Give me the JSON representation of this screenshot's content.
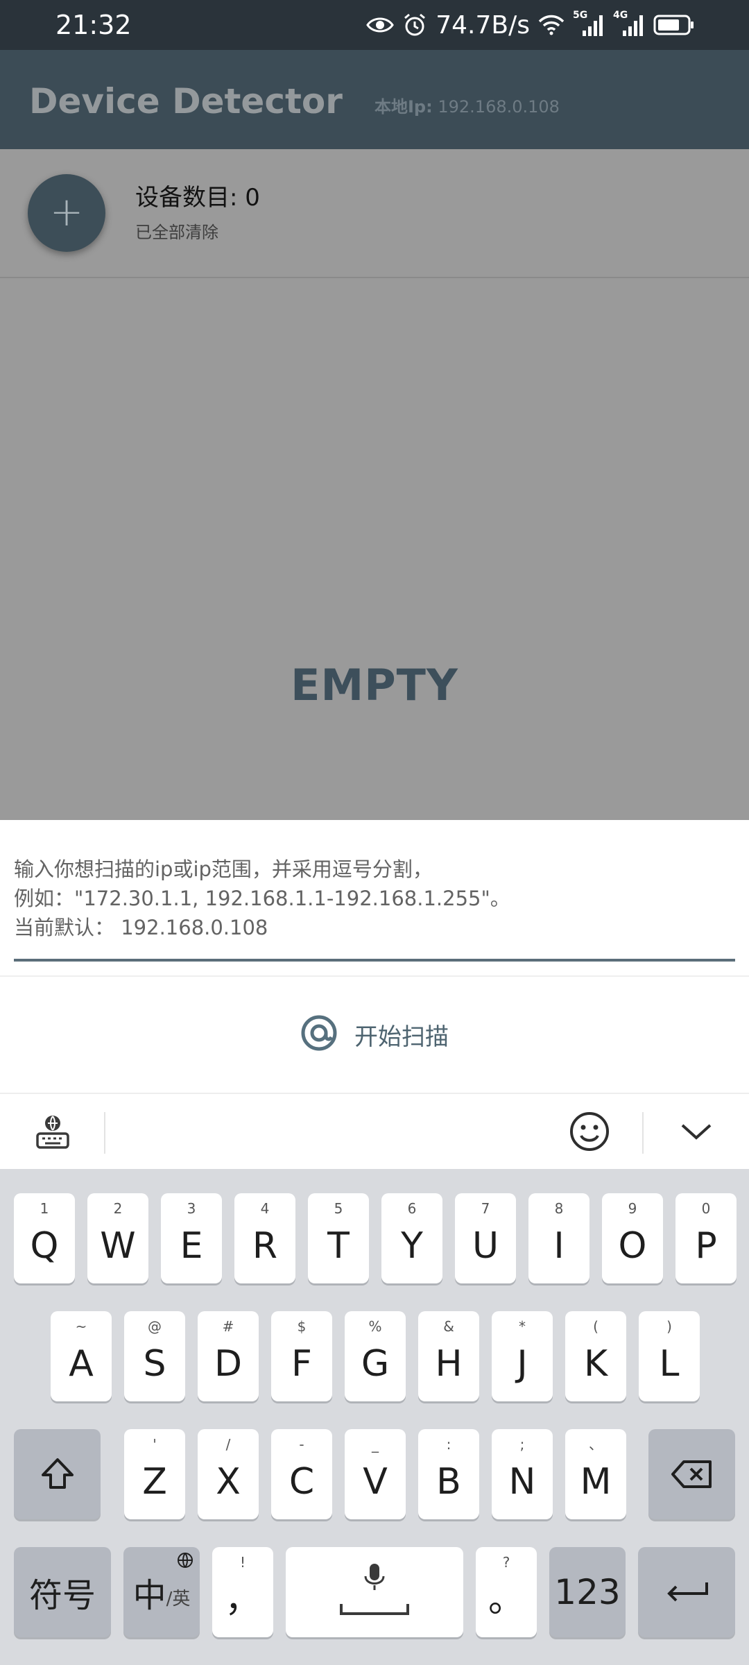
{
  "status_bar": {
    "time": "21:32",
    "net_speed": "74.7B/s",
    "net_5g": "5G",
    "net_4g": "4G",
    "icons": [
      "eye-icon",
      "alarm-icon",
      "wifi-icon",
      "signal-icon",
      "battery-icon"
    ]
  },
  "app_bar": {
    "title": "Device Detector",
    "local_ip_label": "本地Ip:",
    "local_ip_value": "192.168.0.108"
  },
  "device_summary": {
    "add_button": "+",
    "count_text": "设备数目: 0",
    "status_text": "已全部清除"
  },
  "list": {
    "empty_label": "EMPTY"
  },
  "scan_sheet": {
    "hint_line1": "输入你想扫描的ip或ip范围，并采用逗号分割，",
    "hint_line2": "例如：\"172.30.1.1, 192.168.1.1-192.168.1.255\"。",
    "hint_line3": "当前默认：  192.168.0.108",
    "input_value": "",
    "scan_button_label": "开始扫描",
    "scan_icon": "at-sign-icon"
  },
  "keyboard": {
    "row1": [
      {
        "letter": "Q",
        "hint": "1"
      },
      {
        "letter": "W",
        "hint": "2"
      },
      {
        "letter": "E",
        "hint": "3"
      },
      {
        "letter": "R",
        "hint": "4"
      },
      {
        "letter": "T",
        "hint": "5"
      },
      {
        "letter": "Y",
        "hint": "6"
      },
      {
        "letter": "U",
        "hint": "7"
      },
      {
        "letter": "I",
        "hint": "8"
      },
      {
        "letter": "O",
        "hint": "9"
      },
      {
        "letter": "P",
        "hint": "0"
      }
    ],
    "row2": [
      {
        "letter": "A",
        "hint": "~"
      },
      {
        "letter": "S",
        "hint": "@"
      },
      {
        "letter": "D",
        "hint": "#"
      },
      {
        "letter": "F",
        "hint": "$"
      },
      {
        "letter": "G",
        "hint": "%"
      },
      {
        "letter": "H",
        "hint": "&"
      },
      {
        "letter": "J",
        "hint": "*"
      },
      {
        "letter": "K",
        "hint": "("
      },
      {
        "letter": "L",
        "hint": ")"
      }
    ],
    "row3": [
      {
        "letter": "Z",
        "hint": "'"
      },
      {
        "letter": "X",
        "hint": "/"
      },
      {
        "letter": "C",
        "hint": "-"
      },
      {
        "letter": "V",
        "hint": "_"
      },
      {
        "letter": "B",
        "hint": ":"
      },
      {
        "letter": "N",
        "hint": ";"
      },
      {
        "letter": "M",
        "hint": "、"
      }
    ],
    "symbols_label": "符号",
    "lang_main": "中",
    "lang_sub": "/英",
    "comma_label": "，",
    "comma_hint": "!",
    "period_label": "。",
    "period_hint": "?",
    "numbers_label": "123"
  }
}
